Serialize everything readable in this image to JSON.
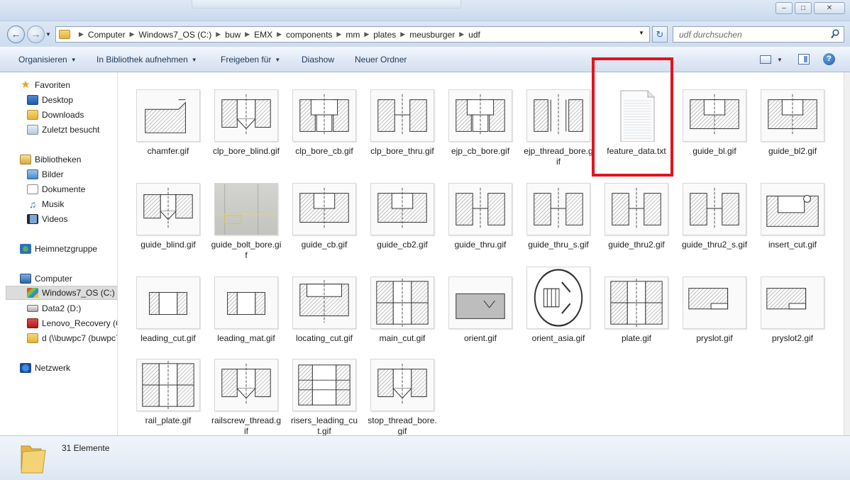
{
  "window": {
    "min_glyph": "–",
    "max_glyph": "□",
    "close_glyph": "✕"
  },
  "address": {
    "crumbs": [
      "Computer",
      "Windows7_OS (C:)",
      "buw",
      "EMX",
      "components",
      "mm",
      "plates",
      "meusburger",
      "udf"
    ],
    "search_placeholder": "udf durchsuchen"
  },
  "toolbar": {
    "organise": "Organisieren",
    "include_library": "In Bibliothek aufnehmen",
    "share": "Freigeben für",
    "slideshow": "Diashow",
    "new_folder": "Neuer Ordner"
  },
  "nav": {
    "favorites": "Favoriten",
    "desktop": "Desktop",
    "downloads": "Downloads",
    "recent": "Zuletzt besucht",
    "libraries": "Bibliotheken",
    "pictures": "Bilder",
    "documents": "Dokumente",
    "music": "Musik",
    "videos": "Videos",
    "homegroup": "Heimnetzgruppe",
    "computer": "Computer",
    "drive_c": "Windows7_OS (C:)",
    "drive_d": "Data2 (D:)",
    "recovery": "Lenovo_Recovery (Q",
    "network_drive": "d (\\\\buwpc7 (buwpc7",
    "network": "Netzwerk"
  },
  "files": [
    {
      "name": "chamfer.gif",
      "type": "chamfer"
    },
    {
      "name": "clp_bore_blind.gif",
      "type": "blind"
    },
    {
      "name": "clp_bore_cb.gif",
      "type": "cb"
    },
    {
      "name": "clp_bore_thru.gif",
      "type": "thru"
    },
    {
      "name": "ejp_cb_bore.gif",
      "type": "cb"
    },
    {
      "name": "ejp_thread_bore.gif",
      "type": "thread"
    },
    {
      "name": "feature_data.txt",
      "type": "txt"
    },
    {
      "name": "guide_bl.gif",
      "type": "pocket"
    },
    {
      "name": "guide_bl2.gif",
      "type": "pocket"
    },
    {
      "name": "guide_blind.gif",
      "type": "blind2"
    },
    {
      "name": "guide_bolt_bore.gif",
      "type": "photo"
    },
    {
      "name": "guide_cb.gif",
      "type": "pocket"
    },
    {
      "name": "guide_cb2.gif",
      "type": "pocket"
    },
    {
      "name": "guide_thru.gif",
      "type": "thru"
    },
    {
      "name": "guide_thru_s.gif",
      "type": "thru"
    },
    {
      "name": "guide_thru2.gif",
      "type": "thru"
    },
    {
      "name": "guide_thru2_s.gif",
      "type": "thru"
    },
    {
      "name": "insert_cut.gif",
      "type": "insert"
    },
    {
      "name": "leading_cut.gif",
      "type": "lead"
    },
    {
      "name": "leading_mat.gif",
      "type": "lead"
    },
    {
      "name": "locating_cut.gif",
      "type": "locating"
    },
    {
      "name": "main_cut.gif",
      "type": "plate"
    },
    {
      "name": "orient.gif",
      "type": "orient"
    },
    {
      "name": "orient_asia.gif",
      "type": "asia"
    },
    {
      "name": "plate.gif",
      "type": "plate"
    },
    {
      "name": "pryslot.gif",
      "type": "slot"
    },
    {
      "name": "pryslot2.gif",
      "type": "slot"
    },
    {
      "name": "rail_plate.gif",
      "type": "plate"
    },
    {
      "name": "railscrew_thread.gif",
      "type": "blind"
    },
    {
      "name": "risers_leading_cut.gif",
      "type": "risers"
    },
    {
      "name": "stop_thread_bore.gif",
      "type": "blind"
    }
  ],
  "status": {
    "count": "31 Elemente"
  },
  "colors": {
    "highlight": "#e3131b",
    "toolbar_text": "#1e395b"
  }
}
